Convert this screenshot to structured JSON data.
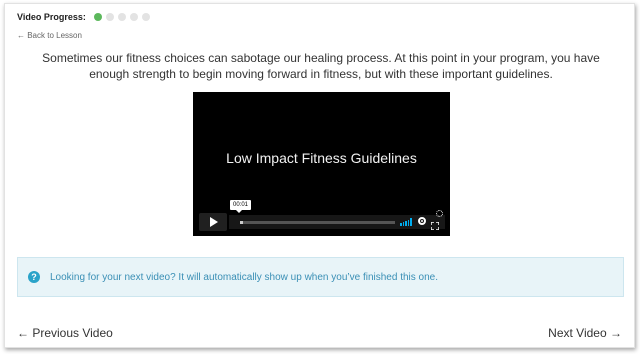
{
  "progress": {
    "label": "Video Progress:",
    "completed": 1,
    "total": 5,
    "done_color": "#5cb85c",
    "pending_color": "#e3e3e3"
  },
  "nav": {
    "back_label": "← Back to Lesson",
    "prev_label": "← Previous Video",
    "next_label": "Next Video →"
  },
  "intro_text": "Sometimes our fitness choices can sabotage our healing process. At this point in your program, you have enough strength to begin moving forward in fitness, but with these important guidelines.",
  "video": {
    "title": "Low Impact Fitness Guidelines",
    "current_time": "00:01",
    "progress_fraction": 0.01,
    "icons": [
      "play-icon",
      "volume-icon",
      "gear-icon",
      "fullscreen-icon",
      "loading-spinner-icon"
    ],
    "accent_color": "#00adef"
  },
  "notice": {
    "icon": "question-circle-icon",
    "text": "Looking for your next video? It will automatically show up when you’ve finished this one."
  }
}
